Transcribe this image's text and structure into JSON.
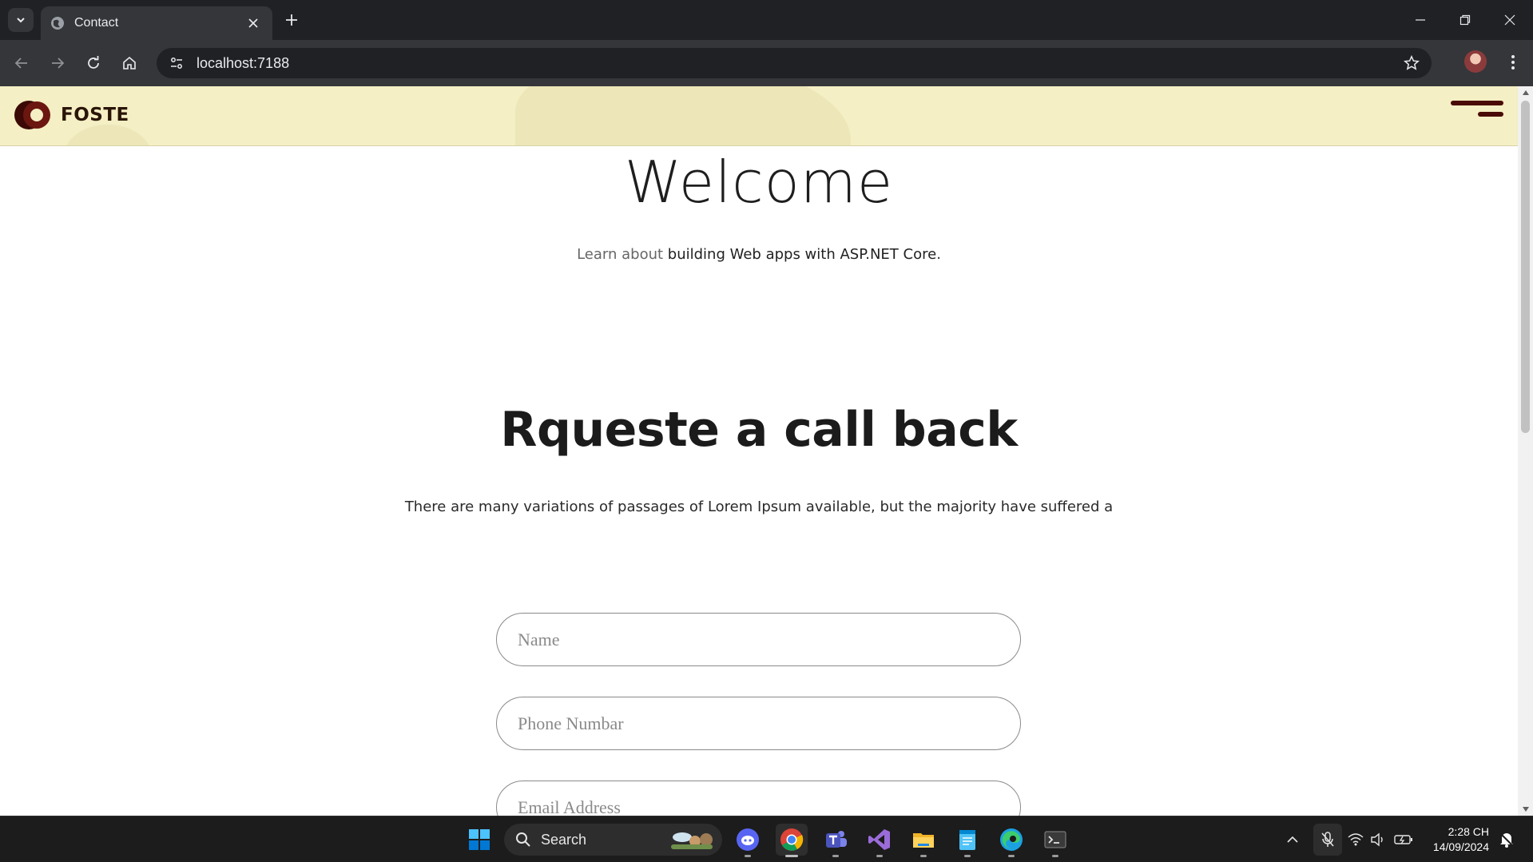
{
  "browser": {
    "tab_title": "Contact",
    "url": "localhost:7188"
  },
  "site": {
    "logo_text": "FOSTE",
    "welcome": "Welcome",
    "lead_muted": "Learn about",
    "lead_link": "building Web apps with ASP.NET Core",
    "lead_end": ".",
    "callback_title": "Rqueste a call back",
    "callback_desc": "There are many variations of passages of Lorem Ipsum available, but the majority have suffered a",
    "form": {
      "name_placeholder": "Name",
      "phone_placeholder": "Phone Numbar",
      "email_placeholder": "Email Address"
    }
  },
  "taskbar": {
    "search_label": "Search",
    "time": "2:28 CH",
    "date": "14/09/2024"
  },
  "icons": {
    "tab_search": "chevron-down-icon",
    "favicon": "globe-icon",
    "site_info": "tune-icon",
    "bookmark": "star-icon",
    "menu": "hamburger-icon"
  },
  "colors": {
    "header_bg": "#f4efc4",
    "brand_dark": "#4a0b06",
    "chrome_dark": "#202124",
    "chrome_toolbar": "#35363a",
    "taskbar_bg": "#1c1c1c"
  }
}
